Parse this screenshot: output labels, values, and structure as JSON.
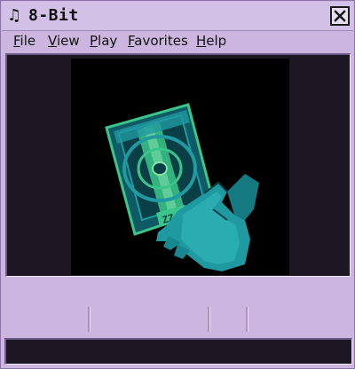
{
  "window": {
    "title": "8-Bit"
  },
  "titlebar": {
    "app_icon": "music-note-icon",
    "close_icon": "close-icon"
  },
  "menu": {
    "items": [
      {
        "id": "file",
        "mnemonic": "F",
        "rest": "ile"
      },
      {
        "id": "view",
        "mnemonic": "V",
        "rest": "iew"
      },
      {
        "id": "play",
        "mnemonic": "P",
        "rest": "lay"
      },
      {
        "id": "favorites",
        "mnemonic": "F",
        "rest": "avorites"
      },
      {
        "id": "help",
        "mnemonic": "H",
        "rest": "elp"
      }
    ]
  },
  "colors": {
    "window_bg": "#ccb5df",
    "viewport_bg": "#1c1723",
    "art_teal": "#1f9aa0",
    "art_green": "#3bc58a",
    "art_dark_teal": "#0f5a64"
  }
}
